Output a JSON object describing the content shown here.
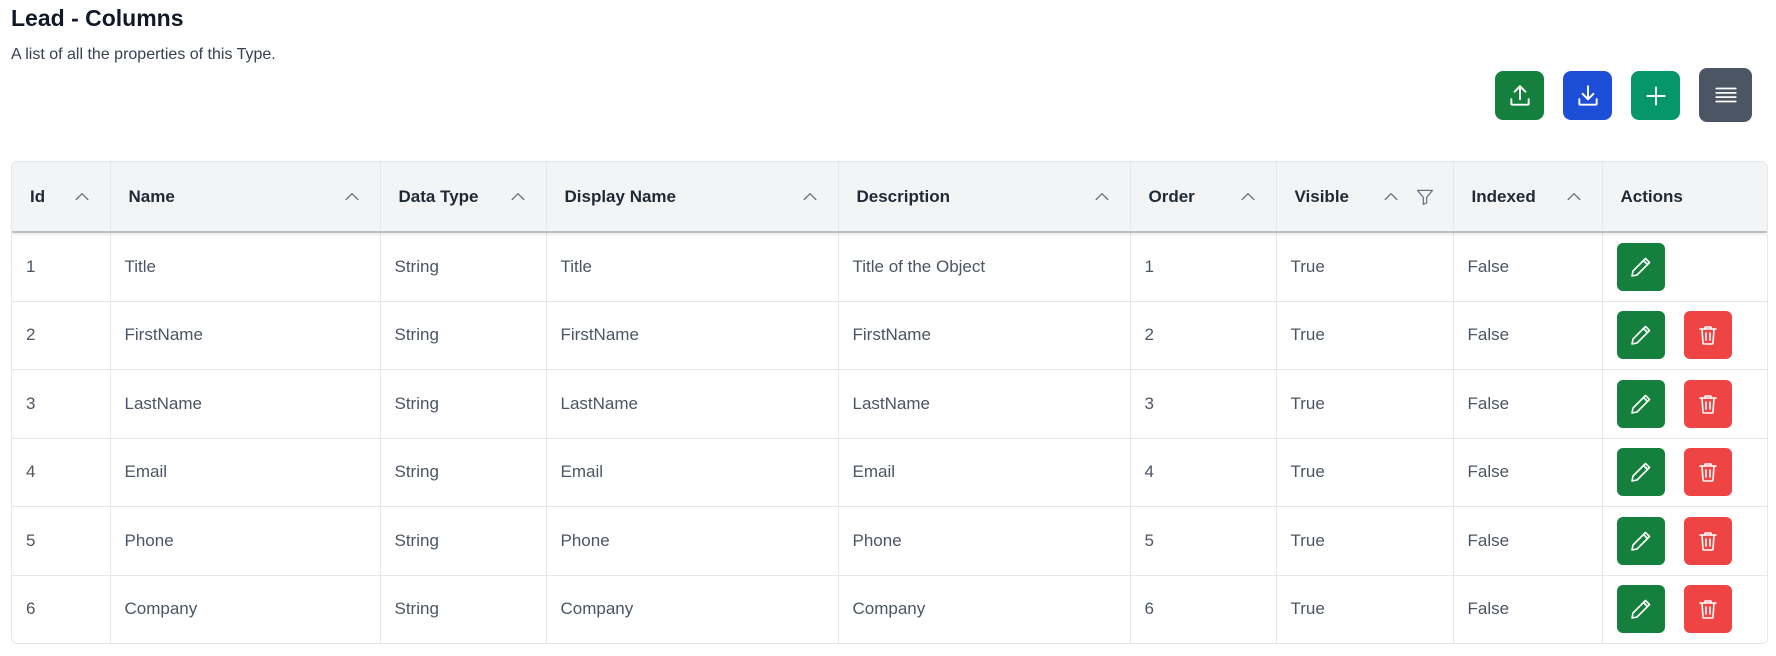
{
  "header": {
    "title": "Lead - Columns",
    "subtitle": "A list of all the properties of this Type."
  },
  "toolbar": {
    "buttons": [
      {
        "icon": "upload-icon",
        "color": "#15803d"
      },
      {
        "icon": "download-icon",
        "color": "#1d4ed8"
      },
      {
        "icon": "plus-icon",
        "color": "#059669"
      },
      {
        "icon": "menu-icon",
        "color": "#4b5563"
      }
    ]
  },
  "table": {
    "columns": [
      {
        "label": "Id",
        "sortable": true,
        "filterable": false
      },
      {
        "label": "Name",
        "sortable": true,
        "filterable": false
      },
      {
        "label": "Data Type",
        "sortable": true,
        "filterable": false
      },
      {
        "label": "Display Name",
        "sortable": true,
        "filterable": false
      },
      {
        "label": "Description",
        "sortable": true,
        "filterable": false
      },
      {
        "label": "Order",
        "sortable": true,
        "filterable": false
      },
      {
        "label": "Visible",
        "sortable": true,
        "filterable": true
      },
      {
        "label": "Indexed",
        "sortable": true,
        "filterable": false
      },
      {
        "label": "Actions",
        "sortable": false,
        "filterable": false
      }
    ],
    "rows": [
      {
        "id": "1",
        "name": "Title",
        "data_type": "String",
        "display_name": "Title",
        "description": "Title of the Object",
        "order": "1",
        "visible": "True",
        "indexed": "False",
        "deletable": false
      },
      {
        "id": "2",
        "name": "FirstName",
        "data_type": "String",
        "display_name": "FirstName",
        "description": "FirstName",
        "order": "2",
        "visible": "True",
        "indexed": "False",
        "deletable": true
      },
      {
        "id": "3",
        "name": "LastName",
        "data_type": "String",
        "display_name": "LastName",
        "description": "LastName",
        "order": "3",
        "visible": "True",
        "indexed": "False",
        "deletable": true
      },
      {
        "id": "4",
        "name": "Email",
        "data_type": "String",
        "display_name": "Email",
        "description": "Email",
        "order": "4",
        "visible": "True",
        "indexed": "False",
        "deletable": true
      },
      {
        "id": "5",
        "name": "Phone",
        "data_type": "String",
        "display_name": "Phone",
        "description": "Phone",
        "order": "5",
        "visible": "True",
        "indexed": "False",
        "deletable": true
      },
      {
        "id": "6",
        "name": "Company",
        "data_type": "String",
        "display_name": "Company",
        "description": "Company",
        "order": "6",
        "visible": "True",
        "indexed": "False",
        "deletable": true
      }
    ]
  },
  "colors": {
    "edit_button": "#15803d",
    "delete_button": "#ef4444",
    "header_bg": "#f3f4f6"
  }
}
